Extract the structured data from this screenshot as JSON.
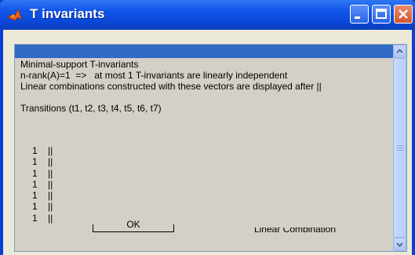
{
  "window": {
    "title": "T invariants",
    "colors": {
      "titlebar": "#0a48d8",
      "selection": "#316ac5",
      "listbox": "#d4d0c8"
    }
  },
  "icons": {
    "app": "matlab-logo-icon",
    "minimize": "minimize-icon",
    "maximize": "maximize-icon",
    "close": "close-icon",
    "scroll_up": "chevron-up-icon",
    "scroll_down": "chevron-down-icon"
  },
  "list": {
    "lines": [
      "Minimal-support T-invariants",
      "n-rank(A)=1  =>   at most 1 T-invariants are linearly independent",
      "Linear combinations constructed with these vectors are displayed after ||",
      "",
      "Transitions (t1, t2, t3, t4, t5, t6, t7)"
    ],
    "values": [
      "1    ||",
      "1    ||",
      "1    ||",
      "1    ||",
      "1    ||",
      "1    ||",
      "1    ||"
    ]
  },
  "buttons": {
    "ok": "OK",
    "linear": "Linear Combination"
  }
}
